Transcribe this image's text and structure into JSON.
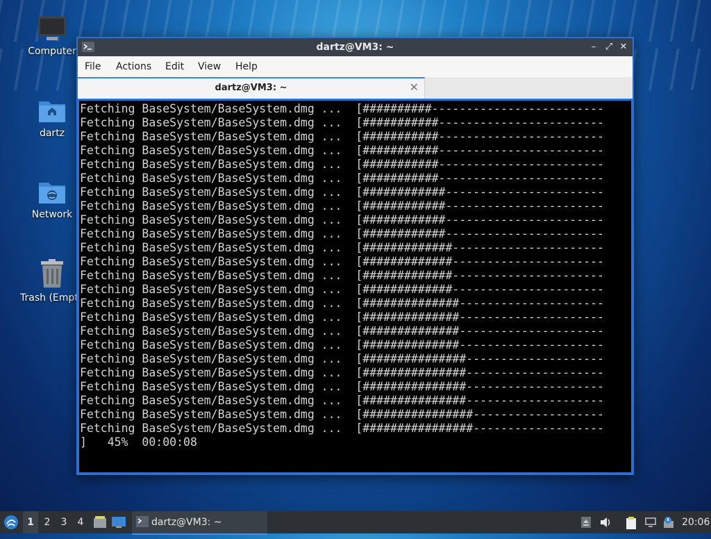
{
  "desktop": {
    "icons": [
      {
        "name": "computer",
        "label": "Computer"
      },
      {
        "name": "home",
        "label": "dartz"
      },
      {
        "name": "network",
        "label": "Network"
      },
      {
        "name": "trash",
        "label": "Trash (Empty)"
      }
    ]
  },
  "window": {
    "title": "dartz@VM3: ~",
    "controls": {
      "minimize": "–",
      "restore": "⤢",
      "close": "✕"
    }
  },
  "menu": [
    "File",
    "Actions",
    "Edit",
    "View",
    "Help"
  ],
  "tab": {
    "label": "dartz@VM3: ~",
    "close": "✕"
  },
  "terminal": {
    "lines": [
      "Fetching BaseSystem/BaseSystem.dmg ...  [##########-------------------------",
      "Fetching BaseSystem/BaseSystem.dmg ...  [###########------------------------",
      "Fetching BaseSystem/BaseSystem.dmg ...  [###########------------------------",
      "Fetching BaseSystem/BaseSystem.dmg ...  [###########------------------------",
      "Fetching BaseSystem/BaseSystem.dmg ...  [###########------------------------",
      "Fetching BaseSystem/BaseSystem.dmg ...  [###########------------------------",
      "Fetching BaseSystem/BaseSystem.dmg ...  [############-----------------------",
      "Fetching BaseSystem/BaseSystem.dmg ...  [############-----------------------",
      "Fetching BaseSystem/BaseSystem.dmg ...  [############-----------------------",
      "Fetching BaseSystem/BaseSystem.dmg ...  [############-----------------------",
      "Fetching BaseSystem/BaseSystem.dmg ...  [#############----------------------",
      "Fetching BaseSystem/BaseSystem.dmg ...  [#############----------------------",
      "Fetching BaseSystem/BaseSystem.dmg ...  [#############----------------------",
      "Fetching BaseSystem/BaseSystem.dmg ...  [#############----------------------",
      "Fetching BaseSystem/BaseSystem.dmg ...  [##############---------------------",
      "Fetching BaseSystem/BaseSystem.dmg ...  [##############---------------------",
      "Fetching BaseSystem/BaseSystem.dmg ...  [##############---------------------",
      "Fetching BaseSystem/BaseSystem.dmg ...  [##############---------------------",
      "Fetching BaseSystem/BaseSystem.dmg ...  [###############--------------------",
      "Fetching BaseSystem/BaseSystem.dmg ...  [###############--------------------",
      "Fetching BaseSystem/BaseSystem.dmg ...  [###############--------------------",
      "Fetching BaseSystem/BaseSystem.dmg ...  [###############--------------------",
      "Fetching BaseSystem/BaseSystem.dmg ...  [################-------------------",
      "Fetching BaseSystem/BaseSystem.dmg ...  [################-------------------",
      "]   45%  00:00:08"
    ]
  },
  "taskbar": {
    "workspaces": [
      "1",
      "2",
      "3",
      "4"
    ],
    "active_workspace": "1",
    "task_title": "dartz@VM3: ~",
    "clock": "20:06"
  },
  "colors": {
    "accent": "#3b87d6",
    "terminal_bg": "#000000",
    "terminal_fg": "#d4d4d4",
    "titlebar": "#39404a",
    "taskbar": "#2d3136"
  }
}
